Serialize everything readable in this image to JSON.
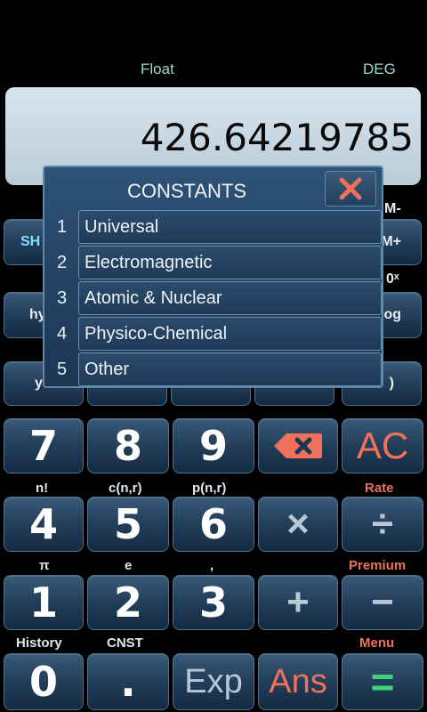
{
  "status": {
    "mode": "Float",
    "angle": "DEG"
  },
  "display": {
    "value": "426.64219785"
  },
  "background_keys": {
    "shift": "SH",
    "hyp": "hy",
    "mminus": "M-",
    "mplus": "M+",
    "pow10": "0ˣ",
    "log": "og",
    "y": "y",
    "paren": ")"
  },
  "keys": {
    "k7": "7",
    "k8": "8",
    "k9": "9",
    "ac": "AC",
    "k4": "4",
    "k5": "5",
    "k6": "6",
    "times": "×",
    "divide": "÷",
    "k1": "1",
    "k2": "2",
    "k3": "3",
    "plus": "+",
    "minus": "−",
    "k0": "0",
    "dot": ".",
    "exp": "Exp",
    "ans": "Ans",
    "equals": "="
  },
  "labels": {
    "fact": "n!",
    "comb": "c(n,r)",
    "perm": "p(n,r)",
    "rate": "Rate",
    "pi": "π",
    "e": "e",
    "comma": ",",
    "premium": "Premium",
    "history": "History",
    "cnst": "CNST",
    "menu": "Menu"
  },
  "dialog": {
    "title": "CONSTANTS",
    "items": [
      {
        "num": "1",
        "label": "Universal"
      },
      {
        "num": "2",
        "label": "Electromagnetic"
      },
      {
        "num": "3",
        "label": "Atomic & Nuclear"
      },
      {
        "num": "4",
        "label": "Physico-Chemical"
      },
      {
        "num": "5",
        "label": "Other"
      }
    ]
  },
  "colors": {
    "accent_red": "#f0715a",
    "accent_green": "#3fd07a",
    "label_cyan": "#9fd7d0"
  }
}
